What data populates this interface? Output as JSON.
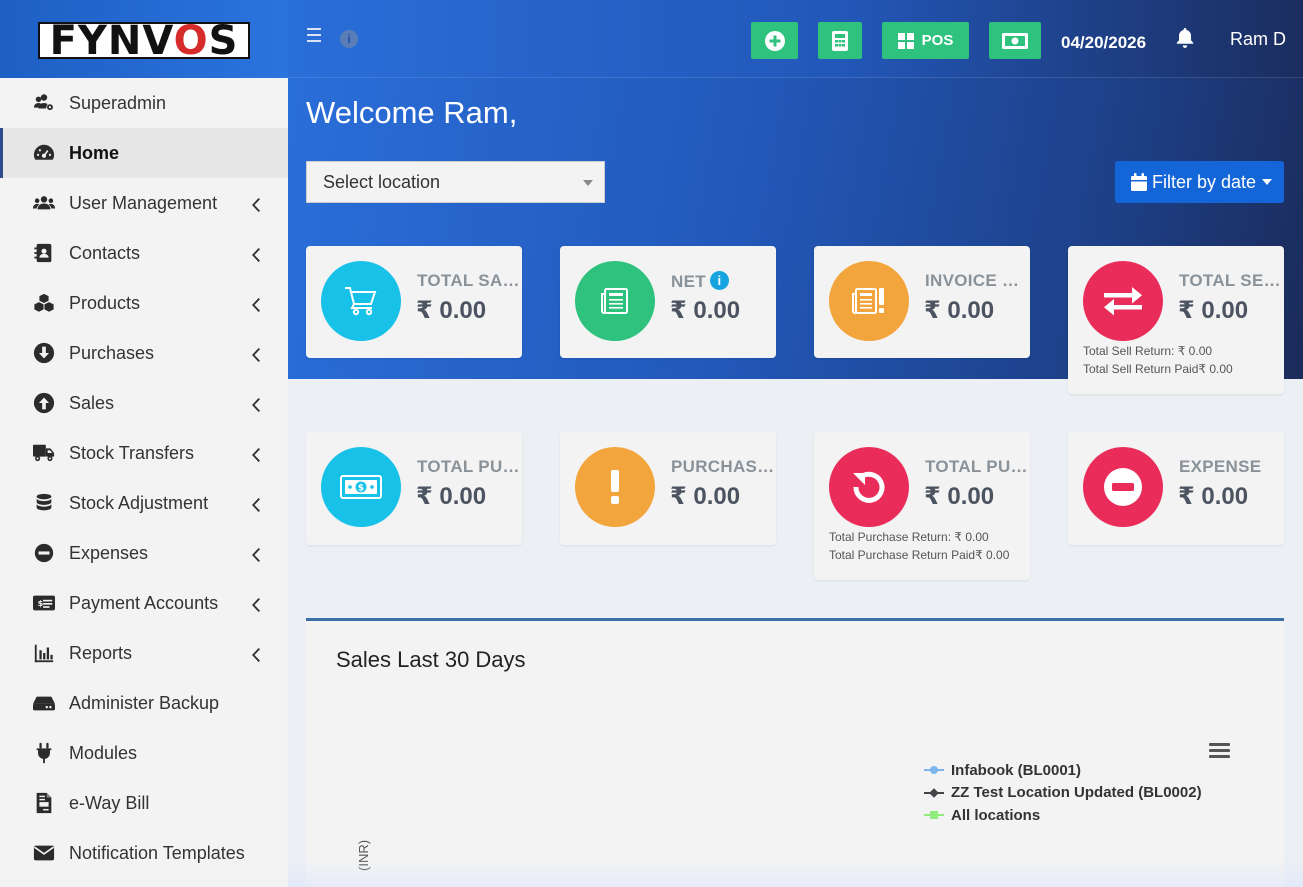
{
  "brand": {
    "logo_text_1": "FYNV",
    "logo_text_2": "O",
    "logo_text_3": "S"
  },
  "sidebar": {
    "items": [
      {
        "label": "Superadmin",
        "icon": "users-gear-icon",
        "has_submenu": false,
        "active": false
      },
      {
        "label": "Home",
        "icon": "dashboard-icon",
        "has_submenu": false,
        "active": true
      },
      {
        "label": "User Management",
        "icon": "users-icon",
        "has_submenu": true,
        "active": false
      },
      {
        "label": "Contacts",
        "icon": "address-book-icon",
        "has_submenu": true,
        "active": false
      },
      {
        "label": "Products",
        "icon": "cubes-icon",
        "has_submenu": true,
        "active": false
      },
      {
        "label": "Purchases",
        "icon": "arrow-circle-down-icon",
        "has_submenu": true,
        "active": false
      },
      {
        "label": "Sales",
        "icon": "arrow-circle-up-icon",
        "has_submenu": true,
        "active": false
      },
      {
        "label": "Stock Transfers",
        "icon": "truck-icon",
        "has_submenu": true,
        "active": false
      },
      {
        "label": "Stock Adjustment",
        "icon": "database-icon",
        "has_submenu": true,
        "active": false
      },
      {
        "label": "Expenses",
        "icon": "minus-circle-icon",
        "has_submenu": true,
        "active": false
      },
      {
        "label": "Payment Accounts",
        "icon": "money-check-icon",
        "has_submenu": true,
        "active": false
      },
      {
        "label": "Reports",
        "icon": "bar-chart-icon",
        "has_submenu": true,
        "active": false
      },
      {
        "label": "Administer Backup",
        "icon": "hdd-icon",
        "has_submenu": false,
        "active": false
      },
      {
        "label": "Modules",
        "icon": "plug-icon",
        "has_submenu": false,
        "active": false
      },
      {
        "label": "e-Way Bill",
        "icon": "file-invoice-icon",
        "has_submenu": false,
        "active": false
      },
      {
        "label": "Notification Templates",
        "icon": "envelope-icon",
        "has_submenu": false,
        "active": false
      }
    ]
  },
  "header": {
    "pos_label": "POS",
    "date": "04/20/2026",
    "user": "Ram D"
  },
  "main": {
    "welcome": "Welcome Ram,",
    "location_select": {
      "value": "Select location"
    },
    "filter_button": "Filter by date",
    "cards_row1": [
      {
        "title": "TOTAL SALES",
        "value": "₹ 0.00",
        "color": "#17c1e8",
        "icon": "cart-icon"
      },
      {
        "title": "NET",
        "value": "₹ 0.00",
        "color": "#2ec27e",
        "icon": "newspaper-icon"
      },
      {
        "title": "INVOICE DUE",
        "value": "₹ 0.00",
        "color": "#f3a53d",
        "icon": "invoice-alert-icon"
      },
      {
        "title": "TOTAL SELL RETURN",
        "value": "₹ 0.00",
        "color": "#ea2c5a",
        "icon": "exchange-icon",
        "sub1": "Total Sell Return: ₹ 0.00",
        "sub2": "Total Sell Return Paid₹ 0.00"
      }
    ],
    "cards_row2": [
      {
        "title": "TOTAL PURCHASE",
        "value": "₹ 0.00",
        "color": "#17c1e8",
        "icon": "money-bill-icon"
      },
      {
        "title": "PURCHASE DUE",
        "value": "₹ 0.00",
        "color": "#f3a53d",
        "icon": "exclamation-icon"
      },
      {
        "title": "TOTAL PURCHASE RETURN",
        "value": "₹ 0.00",
        "color": "#ea2c5a",
        "icon": "undo-icon",
        "sub1": "Total Purchase Return: ₹ 0.00",
        "sub2": "Total Purchase Return Paid₹ 0.00"
      },
      {
        "title": "EXPENSE",
        "value": "₹ 0.00",
        "color": "#ea2c5a",
        "icon": "minus-circle-icon"
      }
    ],
    "chart": {
      "title": "Sales Last 30 Days",
      "y_axis_label": "(INR)",
      "legend": [
        {
          "name": "Infabook (BL0001)",
          "color": "#7cb5ec",
          "marker": "circle"
        },
        {
          "name": "ZZ Test Location Updated (BL0002)",
          "color": "#434348",
          "marker": "diamond"
        },
        {
          "name": "All locations",
          "color": "#90ed7d",
          "marker": "square"
        }
      ]
    }
  }
}
